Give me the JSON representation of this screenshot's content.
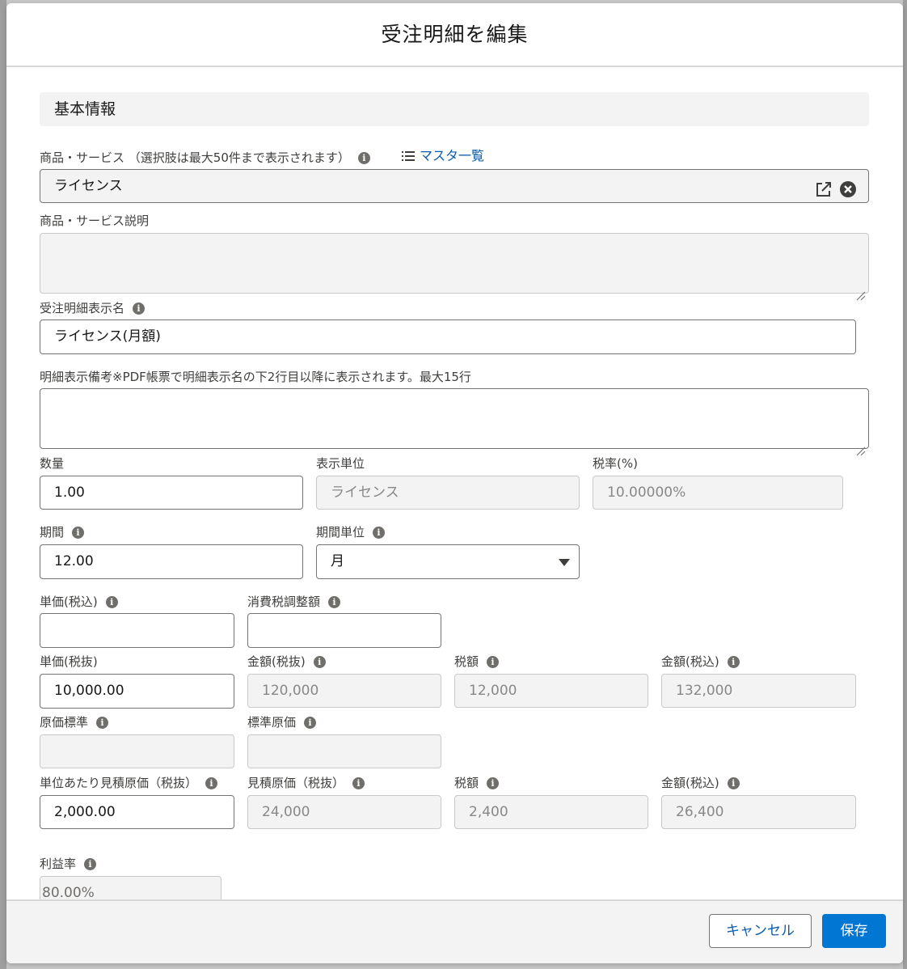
{
  "modal": {
    "title": "受注明細を編集"
  },
  "section": {
    "title": "基本情報"
  },
  "product": {
    "label": "商品・サービス （選択肢は最大50件まで表示されます）",
    "link": "マスタ一覧",
    "value": "ライセンス"
  },
  "product_desc": {
    "label": "商品・サービス説明",
    "value": ""
  },
  "line_name": {
    "label": "受注明細表示名",
    "value": "ライセンス(月額)"
  },
  "line_note": {
    "label": "明細表示備考※PDF帳票で明細表示名の下2行目以降に表示されます。最大15行",
    "value": ""
  },
  "quantity": {
    "label": "数量",
    "value": "1.00"
  },
  "display_unit": {
    "label": "表示単位",
    "value": "ライセンス"
  },
  "tax_rate": {
    "label": "税率(%)",
    "value": "10.00000%"
  },
  "period": {
    "label": "期間",
    "value": "12.00"
  },
  "period_unit": {
    "label": "期間単位",
    "value": "月"
  },
  "unit_price_incl": {
    "label": "単価(税込)",
    "value": ""
  },
  "tax_adjust": {
    "label": "消費税調整額",
    "value": ""
  },
  "unit_price_excl": {
    "label": "単価(税抜)",
    "value": "10,000.00"
  },
  "amount_excl": {
    "label": "金額(税抜)",
    "value": "120,000"
  },
  "tax_amount": {
    "label": "税額",
    "value": "12,000"
  },
  "amount_incl": {
    "label": "金額(税込)",
    "value": "132,000"
  },
  "cost_standard": {
    "label": "原価標準",
    "value": ""
  },
  "standard_cost": {
    "label": "標準原価",
    "value": ""
  },
  "unit_est_cost": {
    "label": "単位あたり見積原価（税抜）",
    "value": "2,000.00"
  },
  "est_cost_excl": {
    "label": "見積原価（税抜）",
    "value": "24,000"
  },
  "cost_tax": {
    "label": "税額",
    "value": "2,400"
  },
  "cost_amount_incl": {
    "label": "金額(税込)",
    "value": "26,400"
  },
  "margin": {
    "label": "利益率",
    "value": "80.00%"
  },
  "footer": {
    "cancel": "キャンセル",
    "save": "保存"
  },
  "colors": {
    "brand": "#0176d3",
    "link": "#0b5cab"
  }
}
